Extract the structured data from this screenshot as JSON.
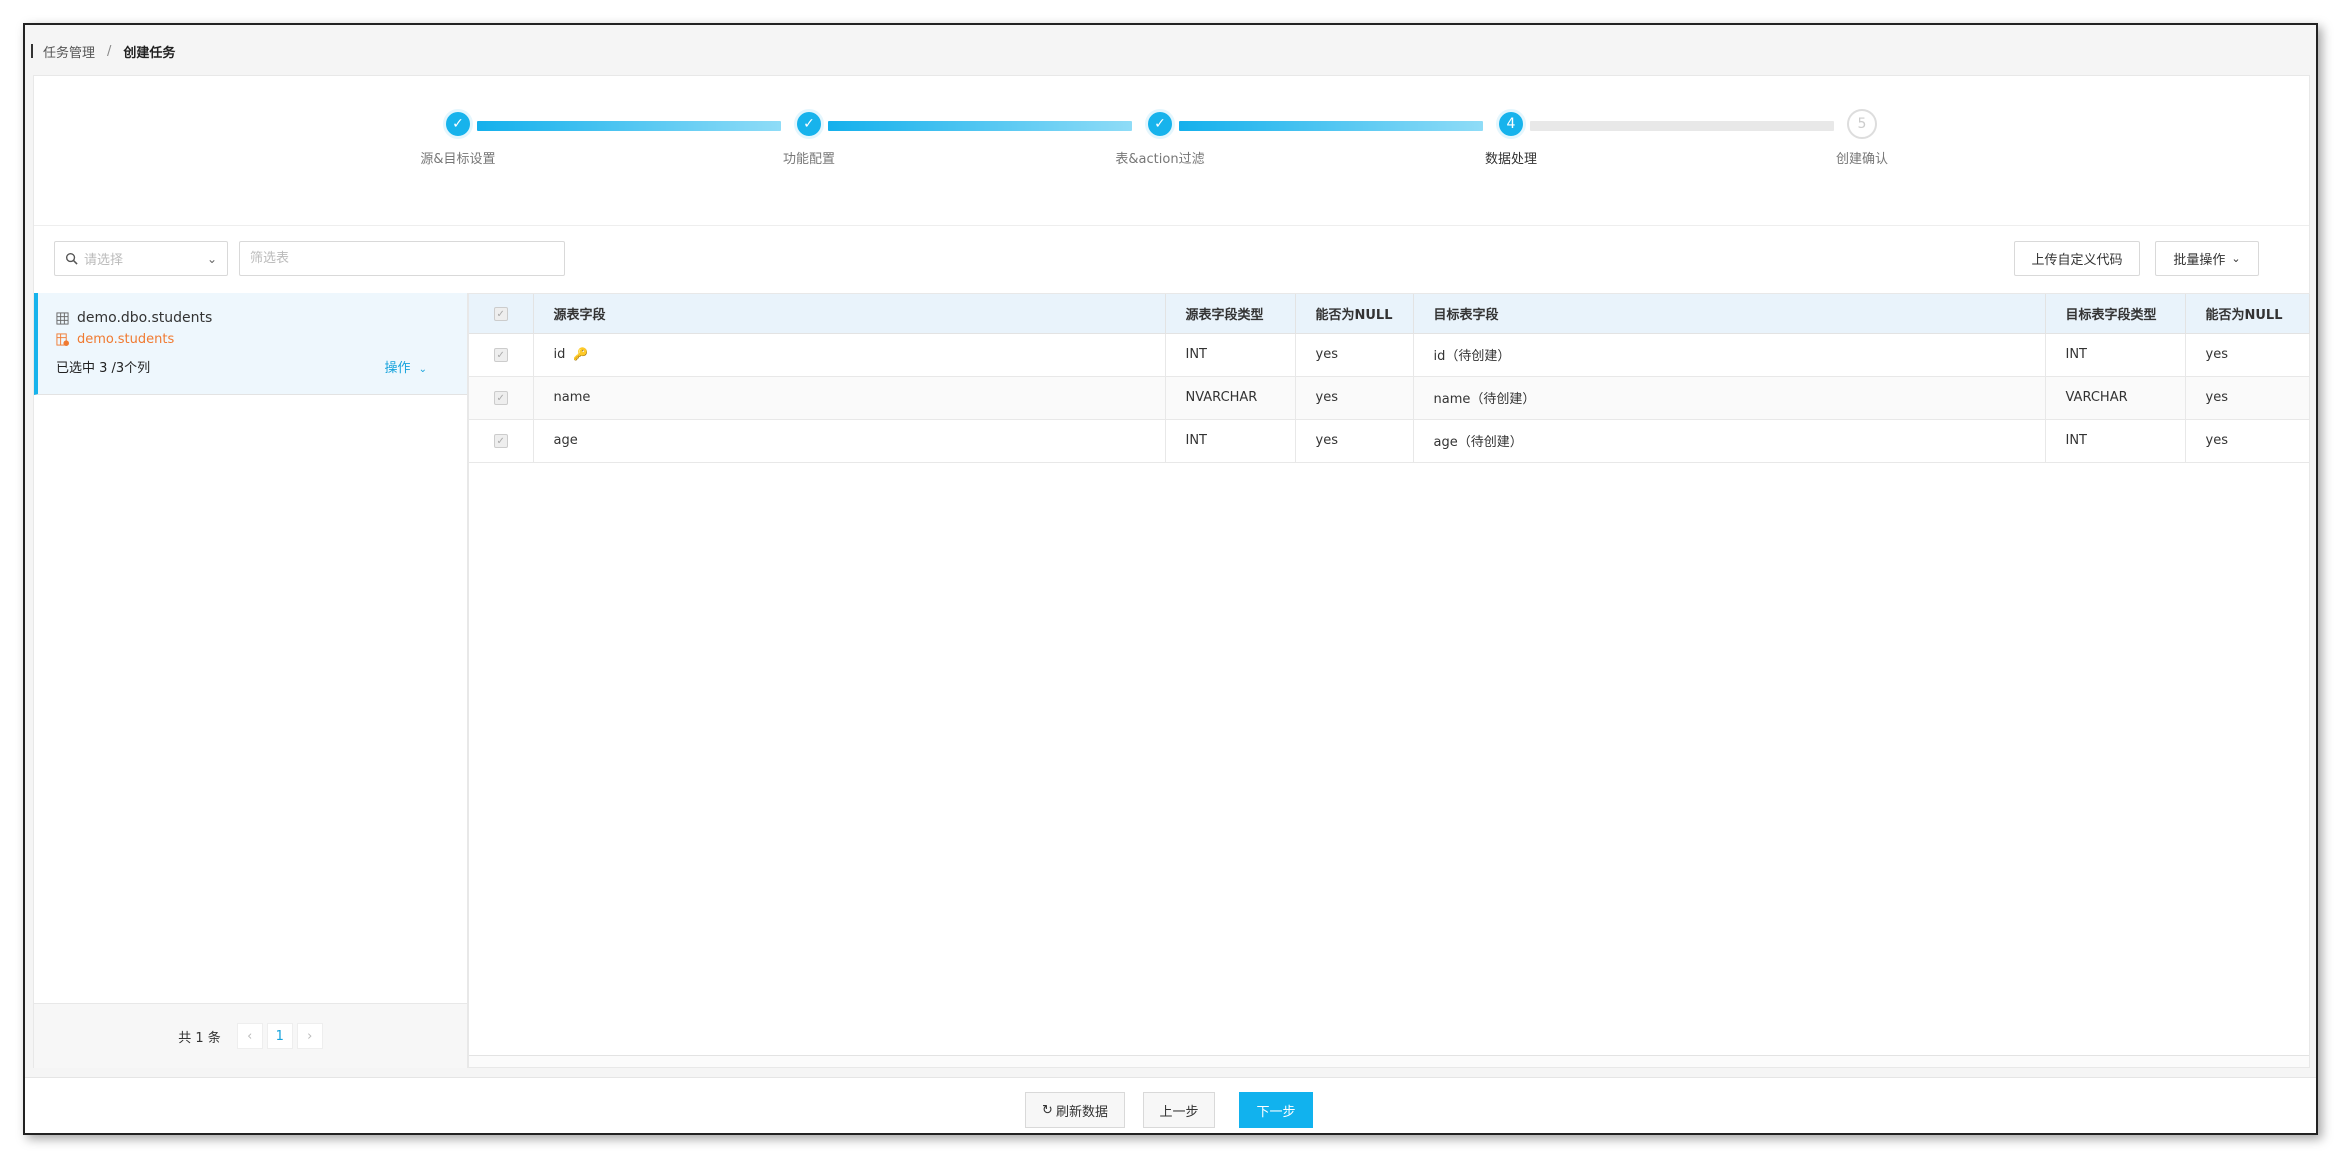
{
  "breadcrumb": {
    "parent": "任务管理",
    "separator": "/",
    "current": "创建任务"
  },
  "steps": [
    {
      "label": "源&目标设置",
      "state": "done",
      "mark": "✓"
    },
    {
      "label": "功能配置",
      "state": "done",
      "mark": "✓"
    },
    {
      "label": "表&action过滤",
      "state": "done",
      "mark": "✓"
    },
    {
      "label": "数据处理",
      "state": "active",
      "mark": "4"
    },
    {
      "label": "创建确认",
      "state": "pending",
      "mark": "5"
    }
  ],
  "toolbar": {
    "select_placeholder": "请选择",
    "filter_placeholder": "筛选表",
    "upload_label": "上传自定义代码",
    "batch_label": "批量操作"
  },
  "left_panel": {
    "source_table": "demo.dbo.students",
    "target_table": "demo.students",
    "selection_text": "已选中 3 /3个列",
    "op_label": "操作",
    "pager": {
      "total_text": "共 1 条",
      "prev": "‹",
      "page": "1",
      "next": "›"
    }
  },
  "table": {
    "headers": [
      "源表字段",
      "源表字段类型",
      "能否为NULL",
      "目标表字段",
      "目标表字段类型",
      "能否为NULL"
    ],
    "rows": [
      {
        "source_field": "id",
        "source_type": "INT",
        "nullable": "yes",
        "target_field": "id（待创建）",
        "target_type": "INT",
        "target_nullable": "yes",
        "is_key": true
      },
      {
        "source_field": "name",
        "source_type": "NVARCHAR",
        "nullable": "yes",
        "target_field": "name（待创建）",
        "target_type": "VARCHAR",
        "target_nullable": "yes",
        "is_key": false
      },
      {
        "source_field": "age",
        "source_type": "INT",
        "nullable": "yes",
        "target_field": "age（待创建）",
        "target_type": "INT",
        "target_nullable": "yes",
        "is_key": false
      }
    ]
  },
  "footer": {
    "refresh_label": "刷新数据",
    "refresh_icon": "↻",
    "prev_label": "上一步",
    "next_label": "下一步"
  },
  "colors": {
    "accent": "#17b3ec",
    "target_text": "#f07a31"
  }
}
